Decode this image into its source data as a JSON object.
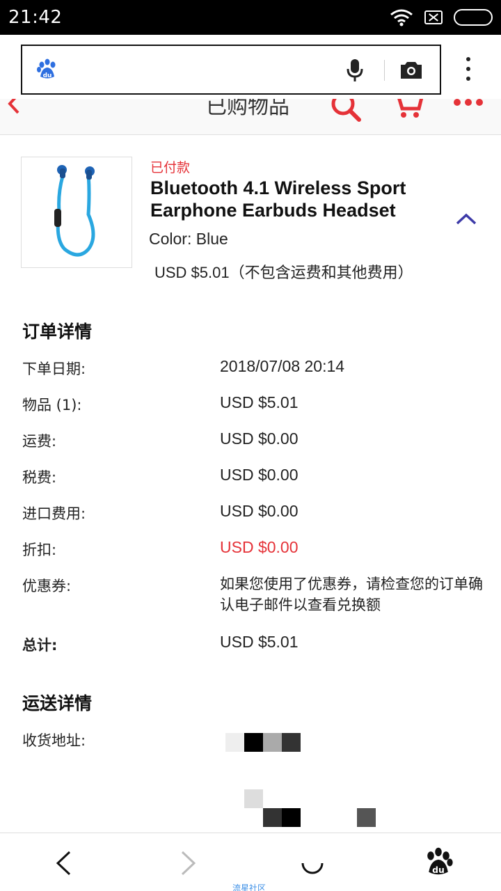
{
  "status_bar": {
    "time": "21:42"
  },
  "page_header": {
    "title": "已购物品"
  },
  "product": {
    "status": "已付款",
    "title": "Bluetooth 4.1 Wireless Sport Earphone Earbuds Headset",
    "color_label": "Color:",
    "color_value": "Blue",
    "price": "USD $5.01（不包含运费和其他费用）"
  },
  "order_details": {
    "title": "订单详情",
    "rows": [
      {
        "label": "下单日期:",
        "value": "2018/07/08 20:14"
      },
      {
        "label": "物品 (1):",
        "value": "USD $5.01"
      },
      {
        "label": "运费:",
        "value": "USD $0.00"
      },
      {
        "label": "税费:",
        "value": "USD $0.00"
      },
      {
        "label": "进口费用:",
        "value": "USD $0.00"
      },
      {
        "label": "折扣:",
        "value": "USD $0.00"
      },
      {
        "label": "优惠券:",
        "value": "如果您使用了优惠券，请检查您的订单确认电子邮件以查看兑换额"
      },
      {
        "label": "总计:",
        "value": "USD $5.01"
      }
    ],
    "discount_color": "#e53238"
  },
  "shipping_details": {
    "title": "运送详情",
    "address_label": "收货地址:"
  },
  "bottom_nav": {
    "watermark": "流星社区"
  },
  "colors": {
    "ebay_red": "#e53238",
    "accent_purple": "#3d3aa8"
  }
}
